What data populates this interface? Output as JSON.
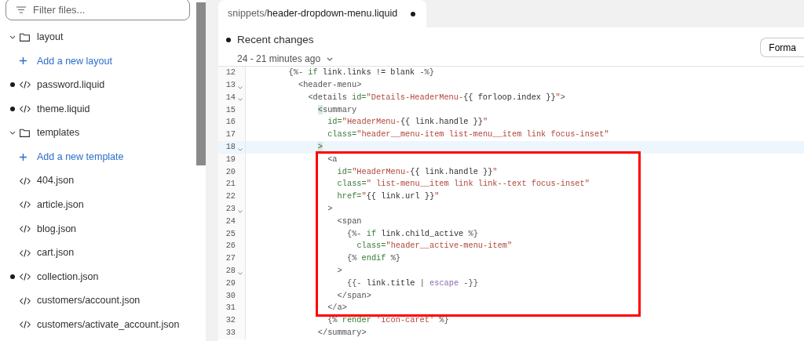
{
  "sidebar": {
    "filter": {
      "placeholder": "Filter files..."
    },
    "tree": [
      {
        "kind": "folder",
        "label": "layout",
        "expanded": true,
        "children": [
          {
            "kind": "add",
            "label": "Add a new layout"
          },
          {
            "kind": "file",
            "label": "password.liquid",
            "modified": true
          },
          {
            "kind": "file",
            "label": "theme.liquid",
            "modified": true
          }
        ]
      },
      {
        "kind": "folder",
        "label": "templates",
        "expanded": true,
        "children": [
          {
            "kind": "add",
            "label": "Add a new template"
          },
          {
            "kind": "file",
            "label": "404.json",
            "modified": false
          },
          {
            "kind": "file",
            "label": "article.json",
            "modified": false
          },
          {
            "kind": "file",
            "label": "blog.json",
            "modified": false
          },
          {
            "kind": "file",
            "label": "cart.json",
            "modified": false
          },
          {
            "kind": "file",
            "label": "collection.json",
            "modified": true
          },
          {
            "kind": "file",
            "label": "customers/account.json",
            "modified": false
          },
          {
            "kind": "file",
            "label": "customers/activate_account.json",
            "modified": false
          }
        ]
      }
    ]
  },
  "editor": {
    "tab": {
      "folder": "snippets/",
      "name": "header-dropdown-menu.liquid",
      "selected": true,
      "modified": true
    },
    "recent": {
      "title": "Recent changes",
      "time": "24 - 21 minutes ago"
    },
    "format_button": "Forma",
    "code_blocks": [
      {
        "kind": "plain",
        "lines": [
          {
            "number": "12",
            "foldable": false,
            "current": false,
            "tokens": [
              {
                "kind": "delim",
                "text": "        {%- "
              },
              {
                "kind": "keyword",
                "text": "if"
              },
              {
                "kind": "plain",
                "text": " link.links != blank "
              },
              {
                "kind": "delim",
                "text": "-%}"
              }
            ]
          },
          {
            "number": "13",
            "foldable": true,
            "current": false,
            "tokens": [
              {
                "kind": "tag",
                "text": "          <header-menu>"
              }
            ]
          },
          {
            "number": "14",
            "foldable": true,
            "current": false,
            "tokens": [
              {
                "kind": "tag",
                "text": "            <details "
              },
              {
                "kind": "attr",
                "text": "id="
              },
              {
                "kind": "string",
                "text": "\"Details-HeaderMenu-"
              },
              {
                "kind": "plain",
                "text": "{{ forloop.index }}"
              },
              {
                "kind": "string",
                "text": "\""
              },
              {
                "kind": "tag",
                "text": ">"
              }
            ]
          },
          {
            "number": "15",
            "foldable": false,
            "current": false,
            "tokens": [
              {
                "kind": "match",
                "text": "              <"
              },
              {
                "kind": "tag",
                "text": "summary"
              }
            ]
          },
          {
            "number": "16",
            "foldable": false,
            "current": false,
            "tokens": [
              {
                "kind": "attr",
                "text": "                id="
              },
              {
                "kind": "string",
                "text": "\"HeaderMenu-"
              },
              {
                "kind": "plain",
                "text": "{{ link.handle }}"
              },
              {
                "kind": "string",
                "text": "\""
              }
            ]
          },
          {
            "number": "17",
            "foldable": false,
            "current": false,
            "tokens": [
              {
                "kind": "attr",
                "text": "                class="
              },
              {
                "kind": "string",
                "text": "\"header__menu-item list-menu__item link focus-inset\""
              }
            ]
          },
          {
            "number": "18",
            "foldable": true,
            "current": true,
            "tokens": [
              {
                "kind": "match",
                "text": "              >"
              }
            ]
          }
        ]
      },
      {
        "kind": "boxed",
        "lines": [
          {
            "number": "19",
            "foldable": false,
            "current": false,
            "tokens": [
              {
                "kind": "tag",
                "text": "                <a"
              }
            ]
          },
          {
            "number": "20",
            "foldable": false,
            "current": false,
            "tokens": [
              {
                "kind": "attr",
                "text": "                  id="
              },
              {
                "kind": "string",
                "text": "\"HeaderMenu-"
              },
              {
                "kind": "plain",
                "text": "{{ link.handle }}"
              },
              {
                "kind": "string",
                "text": "\""
              }
            ]
          },
          {
            "number": "21",
            "foldable": false,
            "current": false,
            "tokens": [
              {
                "kind": "attr",
                "text": "                  class="
              },
              {
                "kind": "string",
                "text": "\" list-menu__item link link--text focus-inset\""
              }
            ]
          },
          {
            "number": "22",
            "foldable": false,
            "current": false,
            "tokens": [
              {
                "kind": "attr",
                "text": "                  href="
              },
              {
                "kind": "string",
                "text": "\""
              },
              {
                "kind": "plain",
                "text": "{{ link.url }}"
              },
              {
                "kind": "string",
                "text": "\""
              }
            ]
          },
          {
            "number": "23",
            "foldable": true,
            "current": false,
            "tokens": [
              {
                "kind": "tag",
                "text": "                >"
              }
            ]
          },
          {
            "number": "24",
            "foldable": false,
            "current": false,
            "tokens": [
              {
                "kind": "tag",
                "text": "                  <span"
              }
            ]
          },
          {
            "number": "25",
            "foldable": false,
            "current": false,
            "tokens": [
              {
                "kind": "delim",
                "text": "                    {%- "
              },
              {
                "kind": "keyword",
                "text": "if"
              },
              {
                "kind": "plain",
                "text": " link.child_active "
              },
              {
                "kind": "delim",
                "text": "%}"
              }
            ]
          },
          {
            "number": "26",
            "foldable": false,
            "current": false,
            "tokens": [
              {
                "kind": "attr",
                "text": "                      class="
              },
              {
                "kind": "string",
                "text": "\"header__active-menu-item\""
              }
            ]
          },
          {
            "number": "27",
            "foldable": false,
            "current": false,
            "tokens": [
              {
                "kind": "delim",
                "text": "                    {% "
              },
              {
                "kind": "keyword",
                "text": "endif"
              },
              {
                "kind": "delim",
                "text": " %}"
              }
            ]
          },
          {
            "number": "28",
            "foldable": true,
            "current": false,
            "tokens": [
              {
                "kind": "tag",
                "text": "                  >"
              }
            ]
          },
          {
            "number": "29",
            "foldable": false,
            "current": false,
            "tokens": [
              {
                "kind": "delim",
                "text": "                    {{-"
              },
              {
                "kind": "plain",
                "text": " link.title "
              },
              {
                "kind": "delim",
                "text": "| "
              },
              {
                "kind": "filter",
                "text": "escape"
              },
              {
                "kind": "delim",
                "text": " -}}"
              }
            ]
          },
          {
            "number": "30",
            "foldable": false,
            "current": false,
            "tokens": [
              {
                "kind": "tag",
                "text": "                  </span>"
              }
            ]
          },
          {
            "number": "31",
            "foldable": false,
            "current": false,
            "tokens": [
              {
                "kind": "tag",
                "text": "                </a>"
              }
            ]
          }
        ]
      },
      {
        "kind": "plain",
        "lines": [
          {
            "number": "32",
            "foldable": false,
            "current": false,
            "tokens": [
              {
                "kind": "delim",
                "text": "                {% "
              },
              {
                "kind": "keyword",
                "text": "render"
              },
              {
                "kind": "string",
                "text": " 'icon-caret'"
              },
              {
                "kind": "delim",
                "text": " %}"
              }
            ]
          },
          {
            "number": "33",
            "foldable": false,
            "current": false,
            "tokens": [
              {
                "kind": "tag",
                "text": "              </summary>"
              }
            ]
          }
        ]
      }
    ]
  }
}
